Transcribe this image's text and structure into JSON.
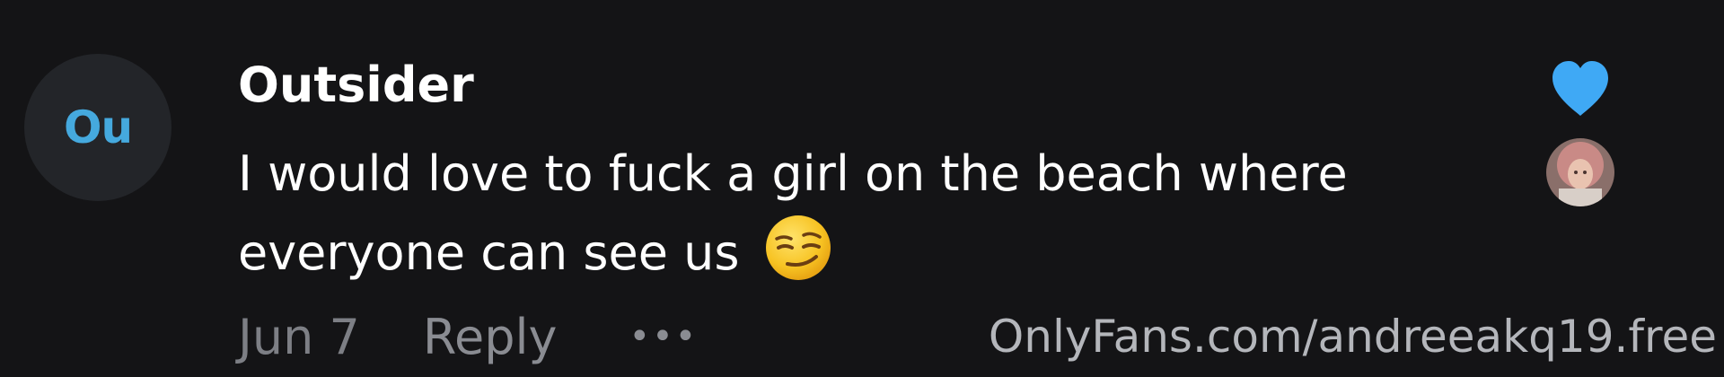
{
  "comment": {
    "avatar_initials": "Ou",
    "username": "Outsider",
    "text_line1": "I would love to fuck a girl on the beach where",
    "text_line2": "everyone can see us",
    "emoji": "smirking-face-emoji",
    "date": "Jun 7",
    "reply_label": "Reply",
    "more_label": "•••"
  },
  "watermark": "OnlyFans.com/andreeakq19.free",
  "icons": {
    "like": "heart-icon",
    "liker": "liker-avatar"
  },
  "colors": {
    "background": "#141416",
    "avatar_bg": "#232529",
    "accent_blue": "#45a9de",
    "heart": "#3fa9f5",
    "text": "#ffffff",
    "muted": "#7d7f85"
  }
}
